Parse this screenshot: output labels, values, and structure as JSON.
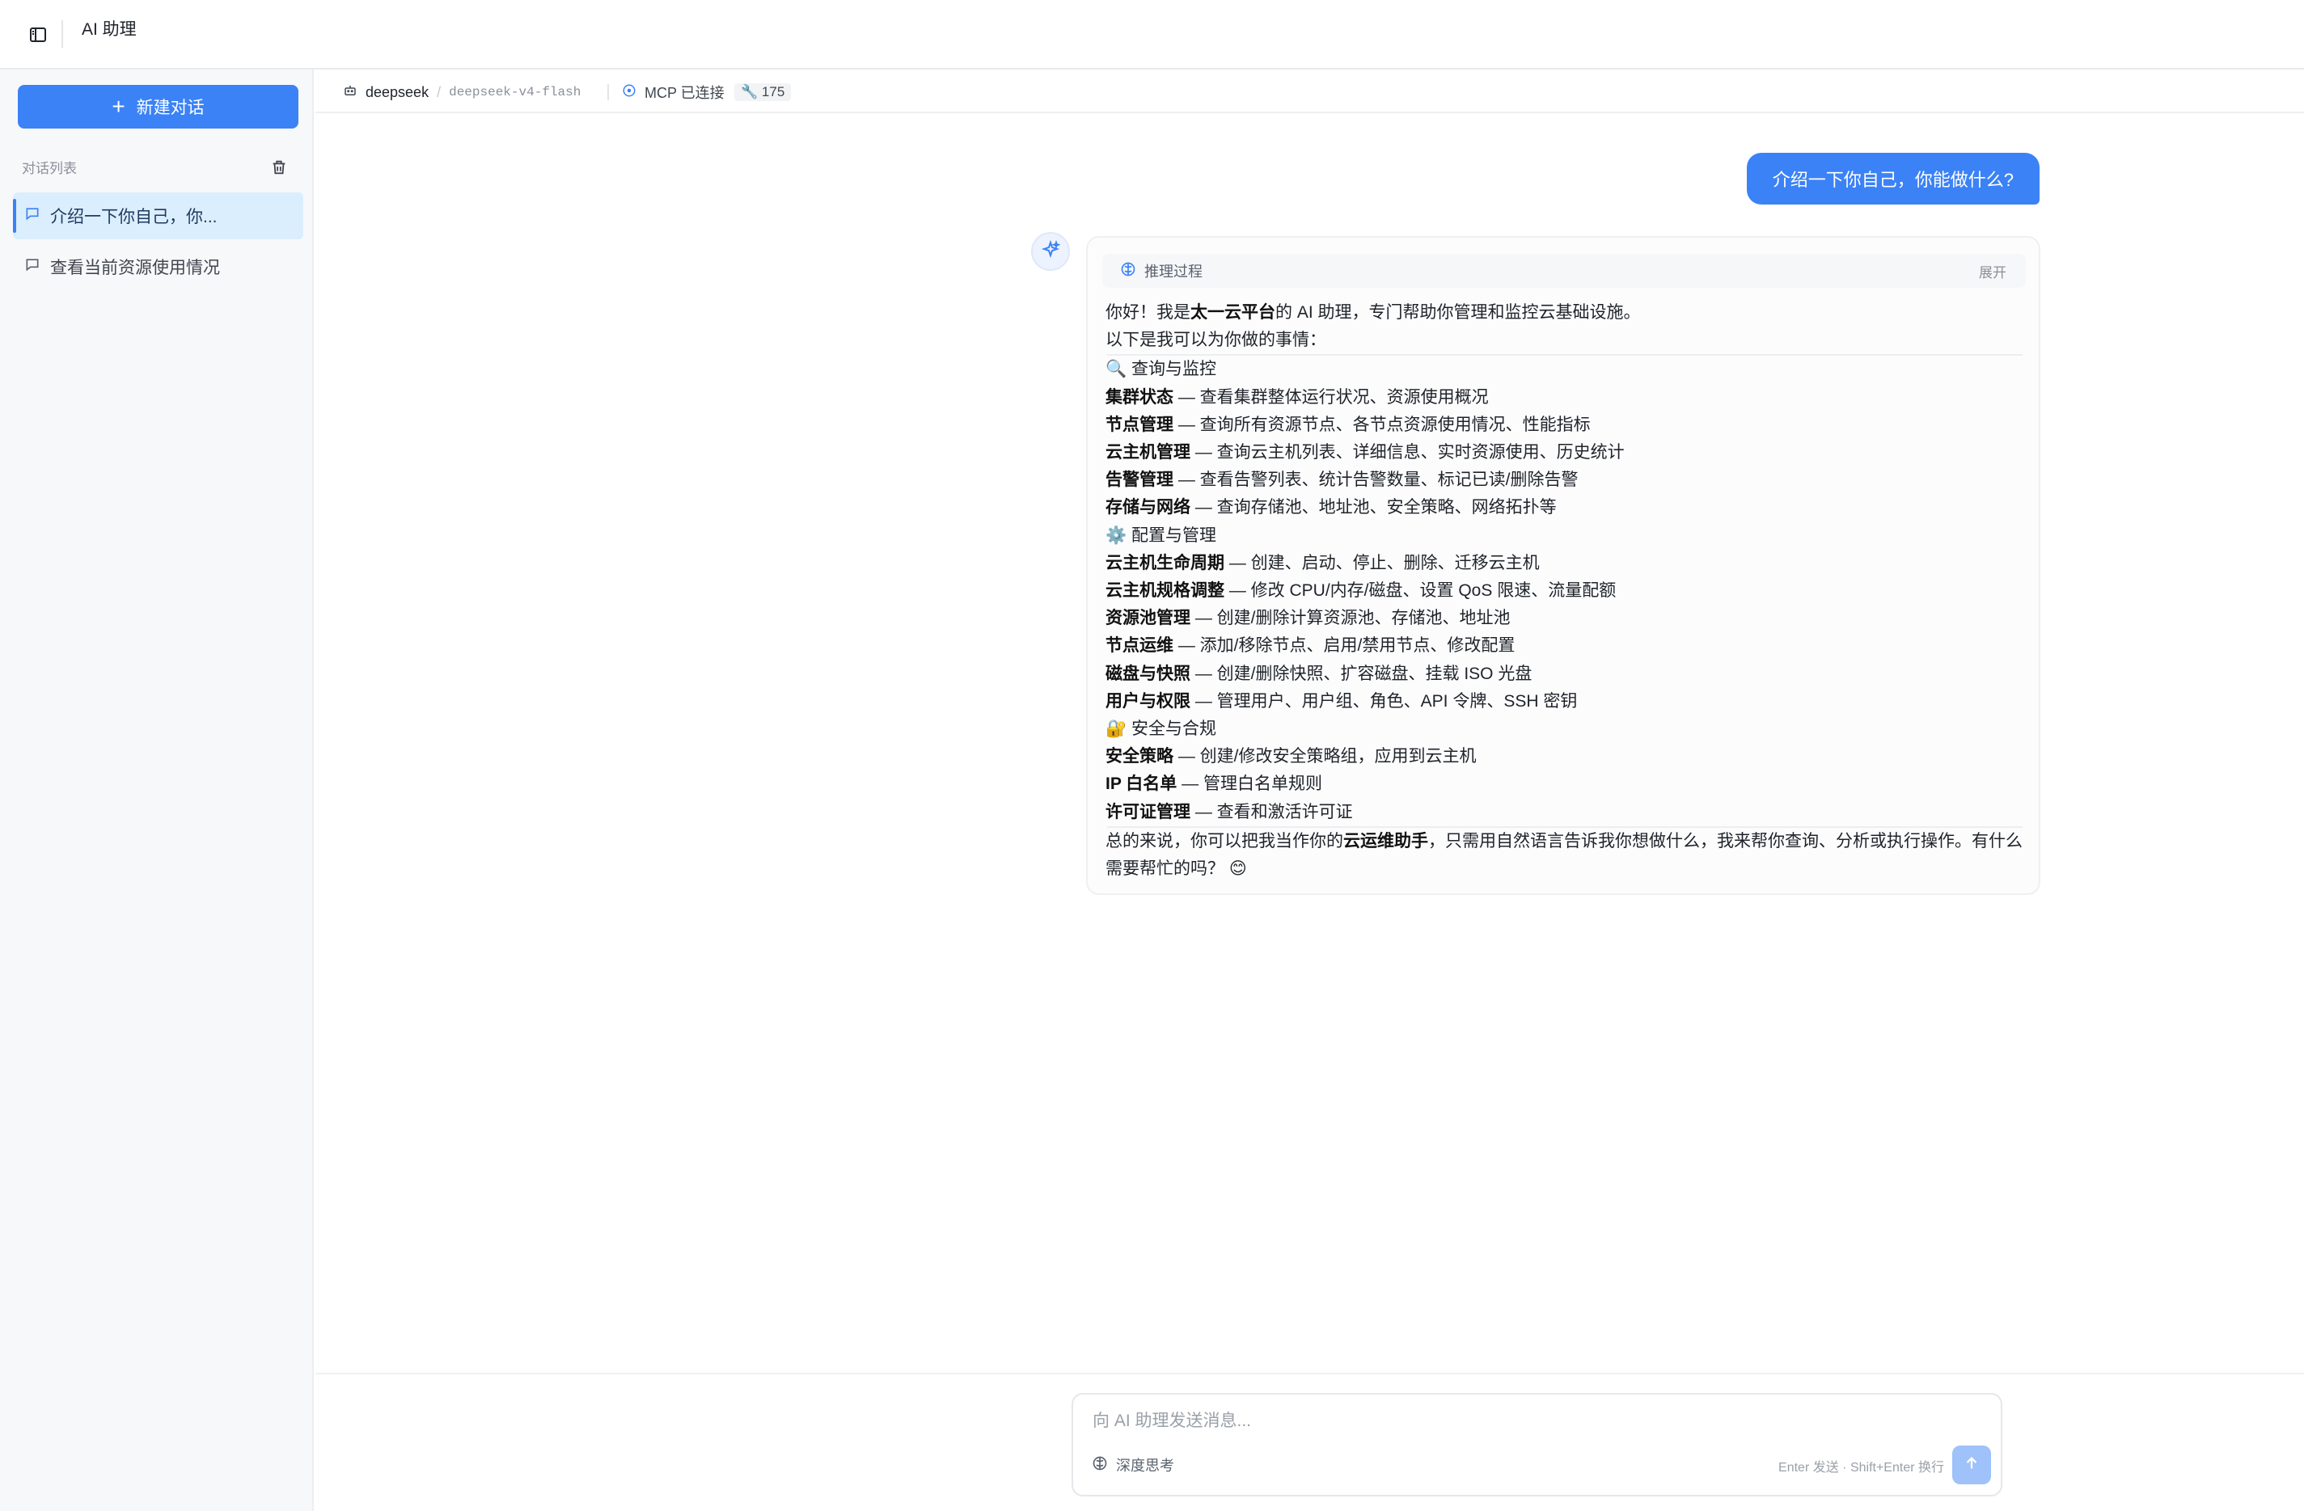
{
  "header": {
    "title": "AI 助理",
    "toggle_icon": "sidebar-toggle-icon"
  },
  "sidebar": {
    "new_chat_label": "新建对话",
    "list_label": "对话列表",
    "conversations": [
      {
        "label": "介绍一下你自己，你...",
        "active": true
      },
      {
        "label": "查看当前资源使用情况",
        "active": false
      }
    ]
  },
  "modelbar": {
    "provider": "deepseek",
    "separator": "/",
    "model": "deepseek-v4-flash",
    "mcp_status": "MCP 已连接",
    "tool_count": "175"
  },
  "chat": {
    "user_message": "介绍一下你自己，你能做什么?",
    "reasoning_label": "推理过程",
    "expand_label": "展开",
    "assistant": {
      "intro_pre": "你好！我是",
      "intro_bold": "太一云平台",
      "intro_post": "的 AI 助理，专门帮助你管理和监控云基础设施。",
      "lead": "以下是我可以为你做的事情：",
      "sections": [
        {
          "emoji": "🔍",
          "title": "查询与监控",
          "items": [
            {
              "name": "集群状态",
              "desc": " — 查看集群整体运行状况、资源使用概况"
            },
            {
              "name": "节点管理",
              "desc": " — 查询所有资源节点、各节点资源使用情况、性能指标"
            },
            {
              "name": "云主机管理",
              "desc": " — 查询云主机列表、详细信息、实时资源使用、历史统计"
            },
            {
              "name": "告警管理",
              "desc": " — 查看告警列表、统计告警数量、标记已读/删除告警"
            },
            {
              "name": "存储与网络",
              "desc": " — 查询存储池、地址池、安全策略、网络拓扑等"
            }
          ]
        },
        {
          "emoji": "⚙️",
          "title": "配置与管理",
          "items": [
            {
              "name": "云主机生命周期",
              "desc": " — 创建、启动、停止、删除、迁移云主机"
            },
            {
              "name": "云主机规格调整",
              "desc": " — 修改 CPU/内存/磁盘、设置 QoS 限速、流量配额"
            },
            {
              "name": "资源池管理",
              "desc": " — 创建/删除计算资源池、存储池、地址池"
            },
            {
              "name": "节点运维",
              "desc": " — 添加/移除节点、启用/禁用节点、修改配置"
            },
            {
              "name": "磁盘与快照",
              "desc": " — 创建/删除快照、扩容磁盘、挂载 ISO 光盘"
            },
            {
              "name": "用户与权限",
              "desc": " — 管理用户、用户组、角色、API 令牌、SSH 密钥"
            }
          ]
        },
        {
          "emoji": "🔐",
          "title": "安全与合规",
          "items": [
            {
              "name": "安全策略",
              "desc": " — 创建/修改安全策略组，应用到云主机"
            },
            {
              "name": "IP 白名单",
              "desc": " — 管理白名单规则"
            },
            {
              "name": "许可证管理",
              "desc": " — 查看和激活许可证"
            }
          ]
        }
      ],
      "summary_pre": "总的来说，你可以把我当作你的",
      "summary_bold": "云运维助手",
      "summary_post": "，只需用自然语言告诉我你想做什么，我来帮你查询、分析或执行操作。有什么需要帮忙的吗？ 😊"
    }
  },
  "composer": {
    "placeholder": "向 AI 助理发送消息...",
    "deep_think_label": "深度思考",
    "hint": "Enter 发送 · Shift+Enter 换行"
  },
  "colors": {
    "accent": "#3b82f6",
    "send_disabled": "#9ec2f9",
    "sidebar_bg": "#f7f8fa"
  }
}
